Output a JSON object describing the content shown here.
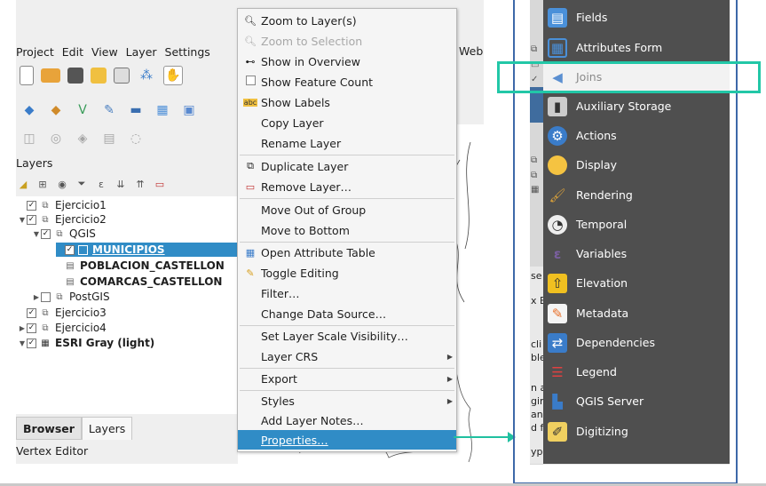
{
  "menubar": {
    "items": [
      {
        "label": "Project",
        "key": "P"
      },
      {
        "label": "Edit",
        "key": "E"
      },
      {
        "label": "View",
        "key": "V"
      },
      {
        "label": "Layer",
        "key": "L"
      },
      {
        "label": "Settings",
        "key": "S"
      }
    ],
    "web": "Web"
  },
  "layers_panel": {
    "title": "Layers",
    "tree": [
      {
        "label": "Ejercicio1",
        "checked": true,
        "expanded": false,
        "level": 0,
        "icon": "group-icon"
      },
      {
        "label": "Ejercicio2",
        "checked": true,
        "expanded": true,
        "level": 0,
        "icon": "group-icon"
      },
      {
        "label": "QGIS",
        "checked": true,
        "expanded": true,
        "level": 1,
        "icon": "group-icon"
      },
      {
        "label": "MUNICIPIOS",
        "checked": true,
        "level": 2,
        "icon": "polygon-layer-icon",
        "selected": true
      },
      {
        "label": "POBLACION_CASTELLON",
        "checked": null,
        "level": 2,
        "icon": "table-icon",
        "bold": true
      },
      {
        "label": "COMARCAS_CASTELLON",
        "checked": null,
        "level": 2,
        "icon": "table-icon",
        "bold": true
      },
      {
        "label": "PostGIS",
        "checked": false,
        "expanded": false,
        "level": 1,
        "icon": "group-icon"
      },
      {
        "label": "Ejercicio3",
        "checked": true,
        "level": 0,
        "icon": "group-icon"
      },
      {
        "label": "Ejercicio4",
        "checked": true,
        "expanded": false,
        "level": 0,
        "icon": "group-icon"
      },
      {
        "label": "ESRI Gray (light)",
        "checked": true,
        "expanded": true,
        "level": 0,
        "icon": "raster-tile-icon",
        "bold": true
      }
    ],
    "tabs": {
      "browser": "Browser",
      "layers": "Layers"
    },
    "vertex_editor": "Vertex Editor"
  },
  "context_menu": {
    "items": [
      {
        "label": "Zoom to Layer(s)",
        "icon": "zoom-icon"
      },
      {
        "label": "Zoom to Selection",
        "icon": "zoom-icon",
        "disabled": true
      },
      {
        "label": "Show in Overview",
        "icon": "overview-icon"
      },
      {
        "label": "Show Feature Count",
        "icon": "checkbox-icon"
      },
      {
        "label": "Show Labels",
        "icon": "labels-icon"
      },
      {
        "label": "Copy Layer"
      },
      {
        "label": "Rename Layer"
      },
      {
        "label": "Duplicate Layer",
        "icon": "duplicate-icon"
      },
      {
        "label": "Remove Layer…",
        "icon": "remove-icon"
      },
      {
        "label": "Move Out of Group"
      },
      {
        "label": "Move to Bottom"
      },
      {
        "label": "Open Attribute Table",
        "icon": "table-icon"
      },
      {
        "label": "Toggle Editing",
        "icon": "pencil-icon"
      },
      {
        "label": "Filter…"
      },
      {
        "label": "Change Data Source…"
      },
      {
        "label": "Set Layer Scale Visibility…"
      },
      {
        "label": "Layer CRS",
        "submenu": true
      },
      {
        "label": "Export",
        "submenu": true
      },
      {
        "label": "Styles",
        "submenu": true
      },
      {
        "label": "Add Layer Notes…"
      },
      {
        "label": "Properties…",
        "active": true
      }
    ]
  },
  "properties_panel": {
    "items": [
      {
        "label": "Fields",
        "icon": "fields-icon",
        "color": "#4a90d9"
      },
      {
        "label": "Attributes Form",
        "icon": "form-icon",
        "color": "#4a90d9"
      },
      {
        "label": "Joins",
        "icon": "joins-icon",
        "color": "#5b8fd1",
        "selected": true
      },
      {
        "label": "Auxiliary Storage",
        "icon": "database-icon",
        "color": "#cccccc"
      },
      {
        "label": "Actions",
        "icon": "actions-icon",
        "color": "#3a7cc9"
      },
      {
        "label": "Display",
        "icon": "display-icon",
        "color": "#f5c341"
      },
      {
        "label": "Rendering",
        "icon": "brush-icon",
        "color": "#d8a03a"
      },
      {
        "label": "Temporal",
        "icon": "clock-icon",
        "color": "#eeeeee"
      },
      {
        "label": "Variables",
        "icon": "variables-icon",
        "color": "#7a5fa0"
      },
      {
        "label": "Elevation",
        "icon": "elevation-icon",
        "color": "#f0c020"
      },
      {
        "label": "Metadata",
        "icon": "metadata-icon",
        "color": "#e8702a"
      },
      {
        "label": "Dependencies",
        "icon": "dependencies-icon",
        "color": "#3a7cc9"
      },
      {
        "label": "Legend",
        "icon": "legend-icon",
        "color": "#e04040"
      },
      {
        "label": "QGIS Server",
        "icon": "server-icon",
        "color": "#3a7cc9"
      },
      {
        "label": "Digitizing",
        "icon": "digitizing-icon",
        "color": "#f0d060"
      }
    ],
    "side_fragments": [
      "se",
      "x E",
      "cli",
      "ble",
      "n a",
      "gin",
      "anv",
      "d fi",
      "ype"
    ]
  },
  "colors": {
    "selection_blue": "#308cc6",
    "highlight_green": "#22c7a7",
    "frame_blue": "#3d68a8",
    "panel_dark": "#4f4f4f"
  }
}
